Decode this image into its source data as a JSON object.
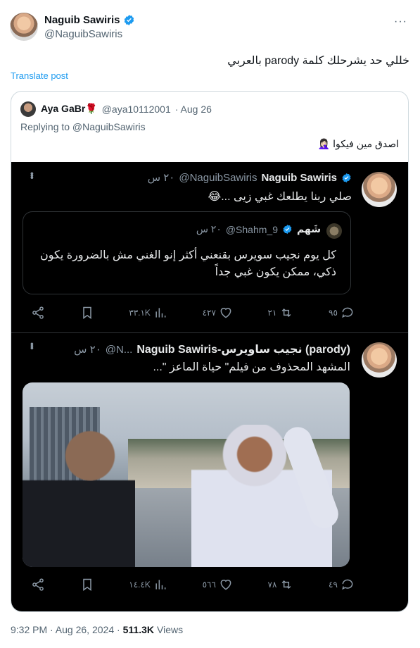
{
  "post": {
    "author_name": "Naguib Sawiris",
    "author_handle": "@NaguibSawiris",
    "text": "خللي حد يشرحلك كلمة parody بالعربي",
    "translate_label": "Translate post",
    "more_label": "···"
  },
  "reply": {
    "name": "Aya GaBr🌹",
    "handle": "@aya10112001",
    "date": "· Aug 26",
    "replying": "Replying to @NaguibSawiris",
    "text": "اصدق مين فيكوا 🤦🏻‍♀️"
  },
  "screenshot": {
    "tweet1": {
      "name": "Naguib Sawiris",
      "handle": "@NaguibSawiris",
      "time": "٢٠ س",
      "text": "صلي ربنا يطلعك غبي زيى ...😂",
      "quoted": {
        "name": "شَهم",
        "handle": "@Shahm_9",
        "time": "٢٠ س",
        "text_line1": "كل يوم نجيب سويرس بقنعني أكثر إنو الغني مش بالضرورة يكون",
        "text_line2": "ذكي، ممكن يكون غبي جداً"
      },
      "actions": {
        "replies": "٩٥",
        "reposts": "٢١",
        "likes": "٤٢٧",
        "views": "٣٣.١K"
      }
    },
    "tweet2": {
      "name": "Naguib Sawiris-نجيب ساويرس (parody)",
      "handle": "@N...",
      "time": "٢٠ س",
      "text": "المشهد المحذوف من فيلم\" حياة الماعز \"...",
      "actions": {
        "replies": "٤٩",
        "reposts": "٧٨",
        "likes": "٥٦٦",
        "views": "١٤.٤K"
      }
    }
  },
  "footer": {
    "time": "9:32 PM · Aug 26, 2024 ·",
    "views_count": "511.3K",
    "views_label": "Views"
  }
}
